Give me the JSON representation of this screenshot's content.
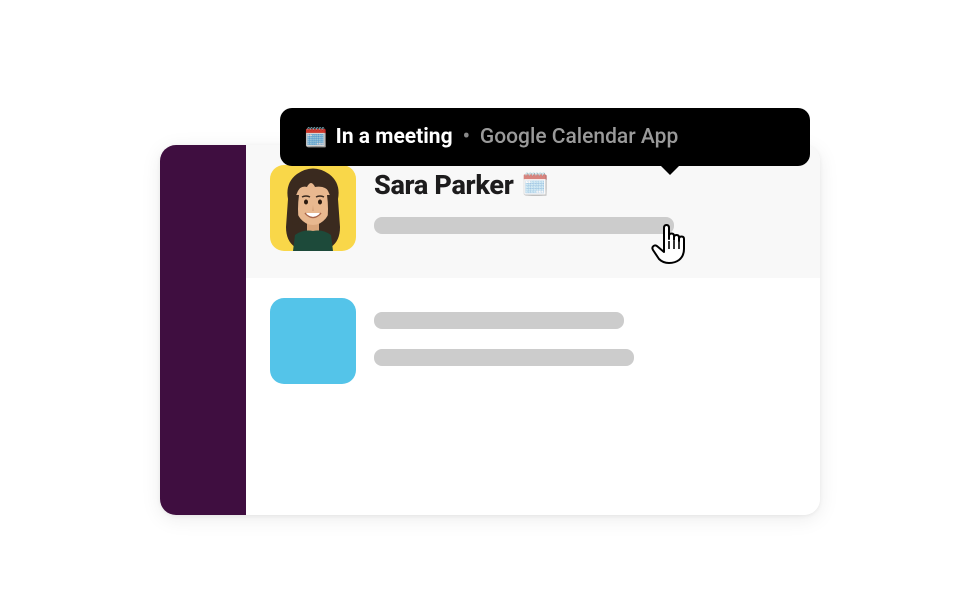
{
  "tooltip": {
    "emoji": "🗓️",
    "status_text": "In a meeting",
    "separator": "•",
    "app_name": "Google Calendar App"
  },
  "messages": [
    {
      "username": "Sara Parker",
      "status_emoji": "🗓️"
    }
  ],
  "colors": {
    "sidebar": "#3f0e40",
    "avatar_yellow": "#f9d749",
    "avatar_blue": "#54c4e9",
    "placeholder": "#cccccc",
    "tooltip_bg": "#000000"
  }
}
